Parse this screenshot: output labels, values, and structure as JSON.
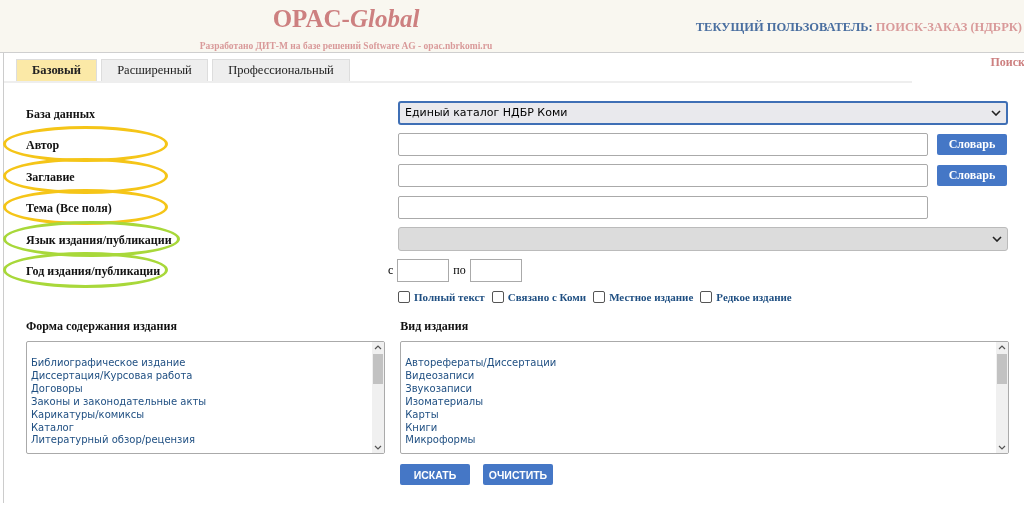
{
  "header": {
    "title": {
      "main": "OPAC-",
      "accent": "Global"
    },
    "subtitle": "Разработано ДИТ-М на базе решений Software AG - opac.nbrkomi.ru",
    "user_label": "ТЕКУЩИЙ ПОЛЬЗОВАТЕЛЬ:",
    "user_name": "ПОИСК-ЗАКАЗ (НДБРК)"
  },
  "tabs": [
    {
      "label": "Базовый",
      "selected": true
    },
    {
      "label": "Расширенный",
      "selected": false
    },
    {
      "label": "Профессиональный",
      "selected": false
    }
  ],
  "page_link": "Поиск",
  "fields": [
    {
      "label": "База данных",
      "kind": "select",
      "value": "Единый каталог НДБР Коми",
      "disabled": false
    },
    {
      "label": "Автор",
      "kind": "text",
      "button": "Словарь",
      "color": "#f5c518"
    },
    {
      "label": "Заглавие",
      "kind": "text",
      "button": "Словарь",
      "color": "#f5c518"
    },
    {
      "label": "Тема (Все поля)",
      "kind": "text",
      "color": "#f5c518"
    },
    {
      "label": "Язык издания/публикации",
      "kind": "select",
      "disabled": true,
      "color": "#a8d83a"
    },
    {
      "label": "Год издания/публикации",
      "kind": "range",
      "from_label": "с",
      "to_label": "по",
      "color": "#a8d83a"
    }
  ],
  "options": [
    {
      "label": "Полный текст",
      "checked": false
    },
    {
      "label": "Связано с Коми",
      "checked": false
    },
    {
      "label": "Местное издание",
      "checked": false
    },
    {
      "label": "Редкое издание",
      "checked": false
    }
  ],
  "lists": [
    {
      "title": "Форма содержания издания",
      "items": [
        "Библиографическое издание",
        "Диссертация/Курсовая работа",
        "Договоры",
        "Законы и законодательные акты",
        "Карикатуры/комиксы",
        "Каталог",
        "Литературный обзор/рецензия"
      ]
    },
    {
      "title": "Вид издания",
      "items": [
        "Авторефераты/Диссертации",
        "Видеозаписи",
        "Звукозаписи",
        "Изоматериалы",
        "Карты",
        "Книги",
        "Микроформы"
      ]
    }
  ],
  "actions": [
    "ИСКАТЬ",
    "ОЧИСТИТЬ"
  ]
}
